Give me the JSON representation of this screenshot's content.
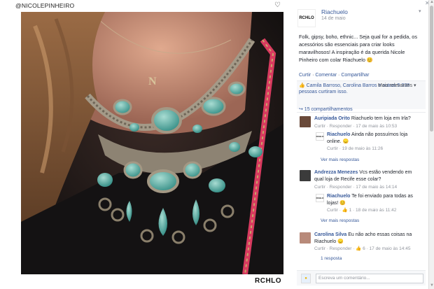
{
  "instagram": {
    "username": "@NICOLEPINHEIRO",
    "watermark": "RCHLO"
  },
  "post": {
    "page_logo": "RCHLO",
    "page_name": "Riachuelo",
    "date": "14 de maio",
    "caption": "Folk, gipsy, boho, ethnic... Seja qual for a pedida, os acessórios são essenciais para criar looks maravilhosos! A inspiração é da querida Nicole Pinheiro com colar Riachuelo 😊",
    "like_label": "Curtir",
    "comment_label": "Comentar",
    "share_label": "Compartilhar",
    "likes_text": "Camila Barroso, Carolina Barros e outras 5.338 pessoas curtiram isso.",
    "relevance_label": "Mais relevantes ▾",
    "shares_text": "↪ 15 compartilhamentos"
  },
  "comments": [
    {
      "author": "Auripiada Orito",
      "text": "Riachuelo tem loja em Irla?",
      "actions": "Curtir · Responder · 17 de maio às 10:53"
    },
    {
      "author": "Riachuelo",
      "text": "Ainda não possuímos loja online. 😞",
      "actions": "Curtir · 19 de maio às 11:26",
      "reply": true
    },
    {
      "more": "Ver mais respostas"
    },
    {
      "author": "Andrezza Menezes",
      "text": "Vcs estão vendendo em qual loja de Recife esse colar?",
      "actions": "Curtir · Responder · 17 de maio às 14:14"
    },
    {
      "author": "Riachuelo",
      "text": "Te foi enviado para todas as lojas! 😊",
      "actions": "Curtir · 👍 1 · 18 de maio às 11:42",
      "reply": true
    },
    {
      "more": "Ver mais respostas"
    },
    {
      "author": "Carolina Silva",
      "text": "Eu não acho essas coisas na Riachuelo 😞",
      "actions": "Curtir · Responder · 👍 6 · 17 de maio às 14:45"
    },
    {
      "more": "1 resposta"
    }
  ],
  "compose": {
    "placeholder": "Escreva um comentário..."
  },
  "colors": {
    "link": "#365899",
    "meta": "#90949c",
    "panel_bg": "#f6f7f9"
  }
}
